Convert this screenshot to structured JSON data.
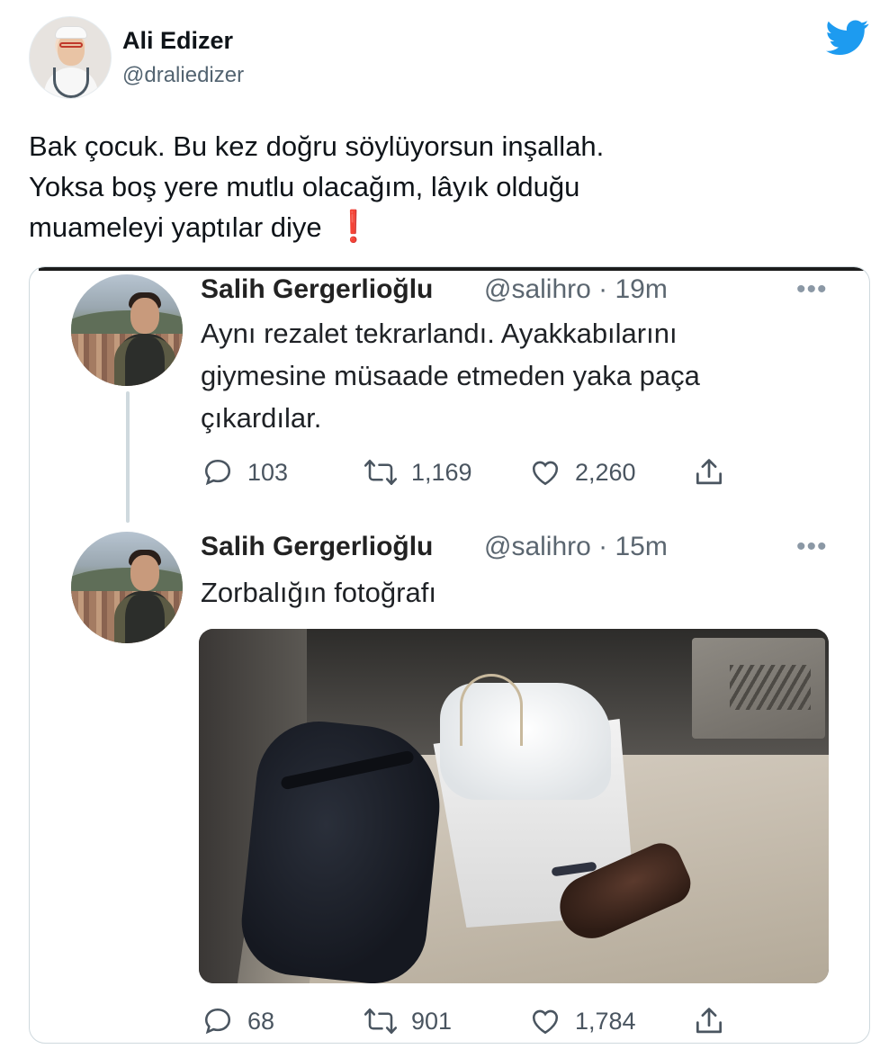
{
  "tweet": {
    "display_name": "Ali Edizer",
    "handle": "@draliedizer",
    "text": "Bak çocuk. Bu kez doğru söylüyorsun inşallah.\nYoksa boş yere mutlu olacağım, lâyık olduğu\nmuameleyi yaptılar diye",
    "emoji": "❗",
    "logo_icon": "twitter-bird-icon",
    "brand_color": "#1d9bf0"
  },
  "quoted": {
    "tweets": [
      {
        "name": "Salih Gergerlioğlu",
        "meta": "@salihro · 19m",
        "more": "•••",
        "text": "Aynı rezalet tekrarlandı. Ayakkabılarını\ngiymesine müsaade etmeden yaka paça\nçıkardılar.",
        "replies": "103",
        "retweets": "1,169",
        "likes": "2,260"
      },
      {
        "name": "Salih Gergerlioğlu",
        "meta": "@salihro · 15m",
        "more": "•••",
        "text": "Zorbalığın fotoğrafı",
        "replies": "68",
        "retweets": "901",
        "likes": "1,784"
      }
    ]
  }
}
